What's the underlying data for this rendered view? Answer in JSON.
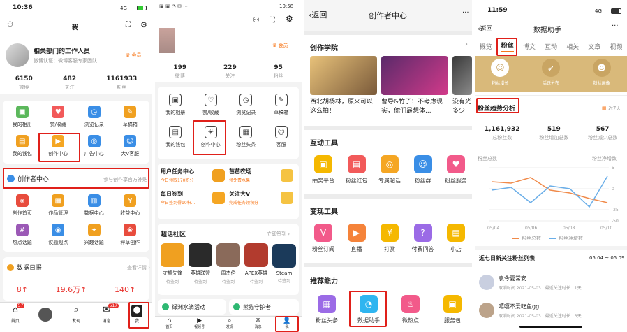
{
  "p1": {
    "status_time": "10:36",
    "status_net": "4G",
    "nav_title": "我",
    "profile_name": "相关部门的工作人员",
    "profile_sub": "微博认证：微博客服专家团队",
    "vip_label": "会员",
    "stats": [
      {
        "v": "6150",
        "l": "微博"
      },
      {
        "v": "482",
        "l": "关注"
      },
      {
        "v": "1161933",
        "l": "粉丝"
      }
    ],
    "grid": [
      {
        "l": "我的相册",
        "c": "#5cb85c",
        "i": "▣"
      },
      {
        "l": "赞/收藏",
        "c": "#f25a5a",
        "i": "♥"
      },
      {
        "l": "浏览记录",
        "c": "#3a8ee6",
        "i": "◷"
      },
      {
        "l": "草稿箱",
        "c": "#f0a020",
        "i": "✎"
      },
      {
        "l": "我的钱包",
        "c": "#f0a020",
        "i": "▤"
      },
      {
        "l": "创作中心",
        "c": "#f5a623",
        "i": "▶"
      },
      {
        "l": "广告中心",
        "c": "#3a8ee6",
        "i": "◎"
      },
      {
        "l": "大V客服",
        "c": "#3a8ee6",
        "i": "☺"
      }
    ],
    "center_title": "创作者中心",
    "center_sub": "参与创作享官方补贴",
    "grid2": [
      {
        "l": "创作首页",
        "c": "#e84c3d",
        "i": "◈"
      },
      {
        "l": "作品管理",
        "c": "#f0a020",
        "i": "▦"
      },
      {
        "l": "数据中心",
        "c": "#3a8ee6",
        "i": "▥"
      },
      {
        "l": "收益中心",
        "c": "#f0a020",
        "i": "¥"
      },
      {
        "l": "热点话题",
        "c": "#9b59b6",
        "i": "#"
      },
      {
        "l": "议题观点",
        "c": "#3a8ee6",
        "i": "◉"
      },
      {
        "l": "兴趣话题",
        "c": "#f0a020",
        "i": "✦"
      },
      {
        "l": "秤草创作",
        "c": "#e84c3d",
        "i": "❀"
      }
    ],
    "daily_title": "数据日报",
    "daily_more": "查看详情 ›",
    "daily": [
      "8↑",
      "19.6万↑",
      "140↑"
    ],
    "tabs": [
      {
        "l": "首页",
        "b": "57"
      },
      {
        "l": "",
        "b": ""
      },
      {
        "l": "发现",
        "b": ""
      },
      {
        "l": "消息",
        "b": "517"
      },
      {
        "l": "我",
        "b": ""
      }
    ]
  },
  "p2": {
    "status_time": "10:58",
    "vip_label": "会员",
    "stats": [
      {
        "v": "199",
        "l": "微博"
      },
      {
        "v": "229",
        "l": "关注"
      },
      {
        "v": "95",
        "l": "粉丝"
      }
    ],
    "grid": [
      {
        "l": "我的相册",
        "i": "▣"
      },
      {
        "l": "赞/收藏",
        "i": "♡"
      },
      {
        "l": "浏览记录",
        "i": "◷"
      },
      {
        "l": "草稿箱",
        "i": "✎"
      },
      {
        "l": "我的钱包",
        "i": "▤"
      },
      {
        "l": "创作中心",
        "i": "☀"
      },
      {
        "l": "粉丝头条",
        "i": "▦"
      },
      {
        "l": "客服",
        "i": "☺"
      }
    ],
    "tasks": [
      {
        "t": "用户任务中心",
        "s": "今日领取170积分",
        "c": "#f0a020"
      },
      {
        "t": "芭芭农场",
        "s": "领免费水果",
        "c": "#f5c342"
      },
      {
        "t": "每日签到",
        "s": "今日签到得10积...",
        "c": "#f5a623"
      },
      {
        "t": "关注大V",
        "s": "完成任务领积分",
        "c": "#f5c342"
      }
    ],
    "community": "超话社区",
    "community_more": "立即签到 ›",
    "games": [
      {
        "n": "守望先锋",
        "s": "待签到",
        "c": "#f0a020"
      },
      {
        "n": "英雄联盟",
        "s": "待签到",
        "c": "#2a2a2a"
      },
      {
        "n": "周杰伦",
        "s": "待签到",
        "c": "#8a6a5a"
      },
      {
        "n": "APEX英雄",
        "s": "待签到",
        "c": "#b23b2e"
      },
      {
        "n": "Steam",
        "s": "待签到",
        "c": "#1b3a5a"
      }
    ],
    "bottom_cards": [
      "绿洲水滴活动",
      "熊猫守护者"
    ],
    "tabs": [
      "首页",
      "视频号",
      "发现",
      "消息",
      "我"
    ],
    "tab_badge": "1"
  },
  "p3": {
    "back": "返回",
    "title": "创作者中心",
    "more": "···",
    "academy": "创作学院",
    "videos": [
      "西北胡杨林，原来可以这么拍！",
      "曹导&竹子：不考虑现实，你们最想体...",
      "没有光多少"
    ],
    "interactive": "互动工具",
    "itools": [
      {
        "l": "抽奖平台",
        "c": "#f5b800",
        "i": "▣"
      },
      {
        "l": "粉丝红包",
        "c": "#f25a5a",
        "i": "▤"
      },
      {
        "l": "专属超话",
        "c": "#f5a623",
        "i": "◎"
      },
      {
        "l": "粉丝群",
        "c": "#3a8ee6",
        "i": "☺"
      },
      {
        "l": "粉丝服务",
        "c": "#f25a8a",
        "i": "♥"
      }
    ],
    "monetize": "变现工具",
    "mtools": [
      {
        "l": "粉丝订阅",
        "c": "#f25a8a",
        "i": "V"
      },
      {
        "l": "直播",
        "c": "#f5833a",
        "i": "▶"
      },
      {
        "l": "打赏",
        "c": "#f5b800",
        "i": "¥"
      },
      {
        "l": "付费问答",
        "c": "#9b6be6",
        "i": "?"
      },
      {
        "l": "小店",
        "c": "#f5b800",
        "i": "▤"
      }
    ],
    "ability": "推荐能力",
    "atools": [
      {
        "l": "粉丝头条",
        "c": "#9b6be6",
        "i": "▦"
      },
      {
        "l": "数据助手",
        "c": "#2fb5f0",
        "i": "◔"
      },
      {
        "l": "微热点",
        "c": "#f25a8a",
        "i": "♨"
      },
      {
        "l": "服务包",
        "c": "#f5b800",
        "i": "▣"
      }
    ]
  },
  "p4": {
    "status_time": "11:59",
    "status_net": "4G",
    "back": "返回",
    "title": "数据助手",
    "more": "···",
    "tabs": [
      "概览",
      "粉丝",
      "博文",
      "互动",
      "相关",
      "文章",
      "视频"
    ],
    "subtabs": [
      "粉丝增长",
      "活跃分布",
      "粉丝画像"
    ],
    "trend_title": "粉丝趋势分析",
    "range": "近7天",
    "stats": [
      {
        "v": "1,161,932",
        "l": "总粉丝数"
      },
      {
        "v": "519",
        "l": "粉丝增加总数"
      },
      {
        "v": "567",
        "l": "粉丝减少总数"
      }
    ],
    "axis_left": "粉丝总数",
    "axis_right": "粉丝净增数",
    "yticks": [
      "5",
      "0",
      "-25",
      "-50"
    ],
    "xticks": [
      "05/04",
      "05/06",
      "05/08",
      "05/10"
    ],
    "legend": [
      "粉丝总数",
      "粉丝净增数"
    ],
    "list_title": "近七日新关注粉丝列表",
    "list_range": "05.04 ~ 05.09",
    "fans": [
      {
        "n": "袁今夏常安",
        "d": "取消时间 2021-05-03",
        "k": "最近关注时长：1天"
      },
      {
        "n": "嘻嘻不爱吃鱼gg",
        "d": "取消时间 2021-05-03",
        "k": "最近关注时长：3天"
      }
    ]
  }
}
